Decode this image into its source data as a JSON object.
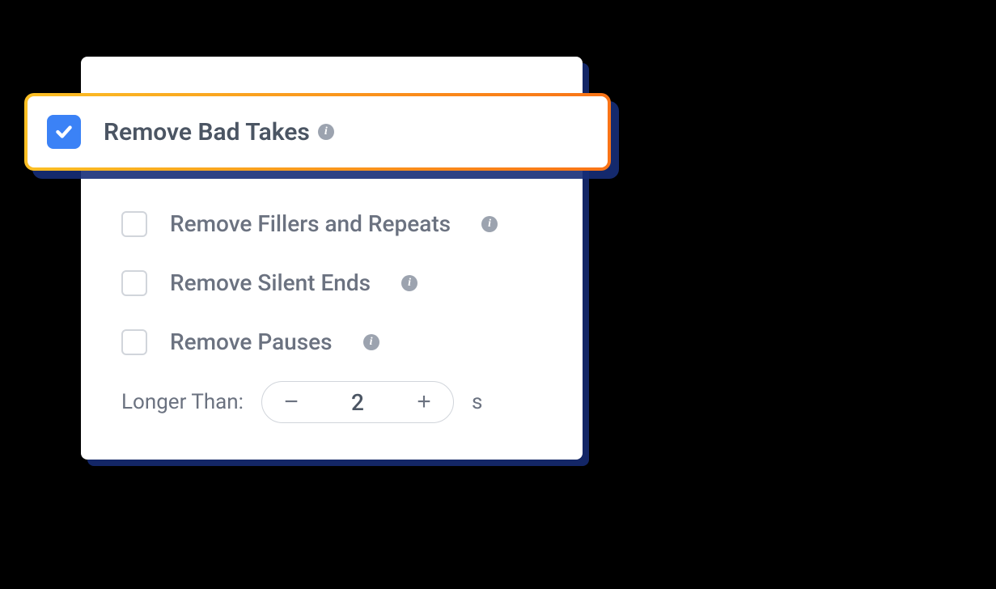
{
  "options": {
    "remove_bad_takes": {
      "label": "Remove Bad Takes",
      "checked": true
    },
    "remove_fillers": {
      "label": "Remove Fillers and Repeats",
      "checked": false
    },
    "remove_silent": {
      "label": "Remove Silent Ends",
      "checked": false
    },
    "remove_pauses": {
      "label": "Remove Pauses",
      "checked": false
    }
  },
  "longer_than": {
    "label": "Longer Than:",
    "value": "2",
    "unit": "s",
    "minus": "−",
    "plus": "+"
  },
  "info_glyph": "i"
}
